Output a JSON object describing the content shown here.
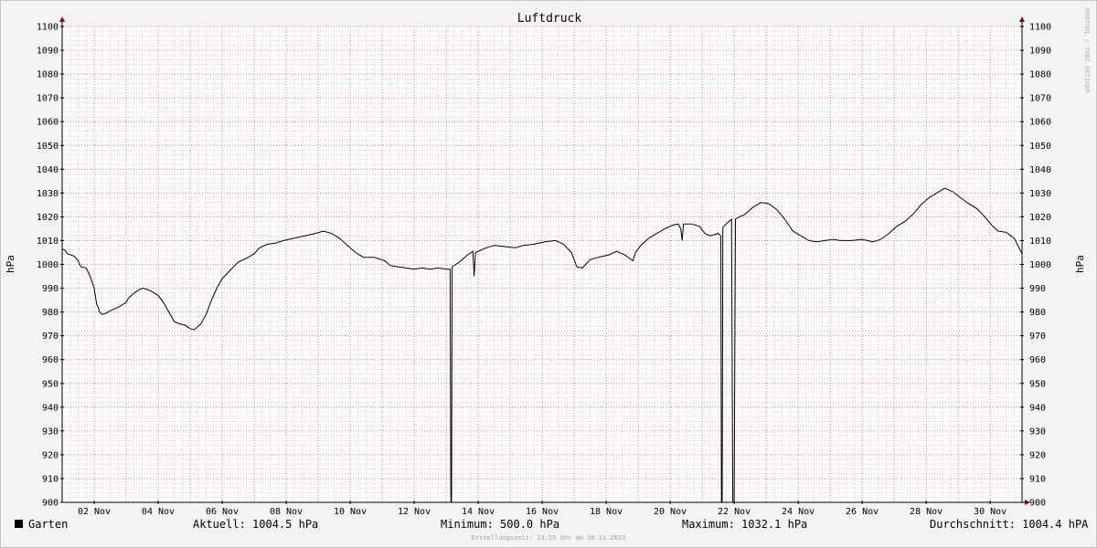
{
  "chart_data": {
    "type": "line",
    "title": "Luftdruck",
    "ylabel": "hPa",
    "ylabel_right": "hPa",
    "ylim": [
      900,
      1100
    ],
    "xlim": [
      "2023-11-01T00:00",
      "2023-11-30T23:55"
    ],
    "yticks": [
      900,
      910,
      920,
      930,
      940,
      950,
      960,
      970,
      980,
      990,
      1000,
      1010,
      1020,
      1030,
      1040,
      1050,
      1060,
      1070,
      1080,
      1090,
      1100
    ],
    "xticks": [
      {
        "label": "02 Nov",
        "value": "2023-11-02T00:00"
      },
      {
        "label": "04 Nov",
        "value": "2023-11-04T00:00"
      },
      {
        "label": "06 Nov",
        "value": "2023-11-06T00:00"
      },
      {
        "label": "08 Nov",
        "value": "2023-11-08T00:00"
      },
      {
        "label": "10 Nov",
        "value": "2023-11-10T00:00"
      },
      {
        "label": "12 Nov",
        "value": "2023-11-12T00:00"
      },
      {
        "label": "14 Nov",
        "value": "2023-11-14T00:00"
      },
      {
        "label": "16 Nov",
        "value": "2023-11-16T00:00"
      },
      {
        "label": "18 Nov",
        "value": "2023-11-18T00:00"
      },
      {
        "label": "20 Nov",
        "value": "2023-11-20T00:00"
      },
      {
        "label": "22 Nov",
        "value": "2023-11-22T00:00"
      },
      {
        "label": "24 Nov",
        "value": "2023-11-24T00:00"
      },
      {
        "label": "26 Nov",
        "value": "2023-11-26T00:00"
      },
      {
        "label": "28 Nov",
        "value": "2023-11-28T00:00"
      },
      {
        "label": "30 Nov",
        "value": "2023-11-30T00:00"
      }
    ],
    "grid": true,
    "series": [
      {
        "name": "Garten",
        "color": "#000000",
        "points": [
          [
            "2023-11-01T00:00",
            1006.5
          ],
          [
            "2023-11-01T02:00",
            1006
          ],
          [
            "2023-11-01T04:00",
            1004.5
          ],
          [
            "2023-11-01T09:00",
            1003.5
          ],
          [
            "2023-11-01T12:00",
            1001.5
          ],
          [
            "2023-11-01T14:00",
            999
          ],
          [
            "2023-11-01T18:00",
            998.5
          ],
          [
            "2023-11-01T21:00",
            995
          ],
          [
            "2023-11-02T00:00",
            990
          ],
          [
            "2023-11-02T02:00",
            983
          ],
          [
            "2023-11-02T03:00",
            982
          ],
          [
            "2023-11-02T04:00",
            980
          ],
          [
            "2023-11-02T06:00",
            979
          ],
          [
            "2023-11-02T09:00",
            979.5
          ],
          [
            "2023-11-02T12:00",
            980.5
          ],
          [
            "2023-11-02T18:00",
            982
          ],
          [
            "2023-11-03T00:00",
            984
          ],
          [
            "2023-11-03T02:00",
            986
          ],
          [
            "2023-11-03T06:00",
            988
          ],
          [
            "2023-11-03T10:00",
            989.5
          ],
          [
            "2023-11-03T13:00",
            990
          ],
          [
            "2023-11-03T18:00",
            989
          ],
          [
            "2023-11-04T00:00",
            987
          ],
          [
            "2023-11-04T04:00",
            984
          ],
          [
            "2023-11-04T08:00",
            980
          ],
          [
            "2023-11-04T12:00",
            976
          ],
          [
            "2023-11-04T16:00",
            975
          ],
          [
            "2023-11-04T20:00",
            974.5
          ],
          [
            "2023-11-05T00:00",
            973
          ],
          [
            "2023-11-05T03:00",
            972.5
          ],
          [
            "2023-11-05T08:00",
            975
          ],
          [
            "2023-11-05T12:00",
            979
          ],
          [
            "2023-11-05T16:00",
            985
          ],
          [
            "2023-11-05T20:00",
            990
          ],
          [
            "2023-11-06T00:00",
            994
          ],
          [
            "2023-11-06T06:00",
            997.5
          ],
          [
            "2023-11-06T12:00",
            1001
          ],
          [
            "2023-11-06T18:00",
            1002.5
          ],
          [
            "2023-11-07T00:00",
            1004.5
          ],
          [
            "2023-11-07T04:00",
            1007
          ],
          [
            "2023-11-07T10:00",
            1008.5
          ],
          [
            "2023-11-07T16:00",
            1009
          ],
          [
            "2023-11-07T22:00",
            1010
          ],
          [
            "2023-11-08T06:00",
            1011
          ],
          [
            "2023-11-08T14:00",
            1012
          ],
          [
            "2023-11-08T22:00",
            1013
          ],
          [
            "2023-11-09T04:00",
            1014
          ],
          [
            "2023-11-09T10:00",
            1013
          ],
          [
            "2023-11-09T16:00",
            1011
          ],
          [
            "2023-11-09T22:00",
            1008
          ],
          [
            "2023-11-10T04:00",
            1005
          ],
          [
            "2023-11-10T10:00",
            1003
          ],
          [
            "2023-11-10T18:00",
            1003
          ],
          [
            "2023-11-11T02:00",
            1001.5
          ],
          [
            "2023-11-11T06:00",
            999.5
          ],
          [
            "2023-11-11T12:00",
            999
          ],
          [
            "2023-11-11T18:00",
            998.5
          ],
          [
            "2023-11-12T00:00",
            998
          ],
          [
            "2023-11-12T06:00",
            998.5
          ],
          [
            "2023-11-12T12:00",
            998
          ],
          [
            "2023-11-12T18:00",
            998.5
          ],
          [
            "2023-11-13T00:00",
            998
          ],
          [
            "2023-11-13T03:00",
            998
          ],
          [
            "2023-11-13T03:30",
            900
          ],
          [
            "2023-11-13T04:00",
            900
          ],
          [
            "2023-11-13T04:30",
            999
          ],
          [
            "2023-11-13T10:00",
            1001
          ],
          [
            "2023-11-13T16:00",
            1004
          ],
          [
            "2023-11-13T20:00",
            1005.5
          ],
          [
            "2023-11-13T21:00",
            995
          ],
          [
            "2023-11-13T22:00",
            1005
          ],
          [
            "2023-11-14T06:00",
            1007
          ],
          [
            "2023-11-14T12:00",
            1008
          ],
          [
            "2023-11-14T20:00",
            1007.5
          ],
          [
            "2023-11-15T04:00",
            1007
          ],
          [
            "2023-11-15T10:00",
            1008
          ],
          [
            "2023-11-15T18:00",
            1008.5
          ],
          [
            "2023-11-16T02:00",
            1009.5
          ],
          [
            "2023-11-16T10:00",
            1010
          ],
          [
            "2023-11-16T16:00",
            1008.5
          ],
          [
            "2023-11-16T22:00",
            1005
          ],
          [
            "2023-11-17T02:00",
            999
          ],
          [
            "2023-11-17T06:00",
            998.5
          ],
          [
            "2023-11-17T12:00",
            1002
          ],
          [
            "2023-11-17T18:00",
            1003
          ],
          [
            "2023-11-18T02:00",
            1004
          ],
          [
            "2023-11-18T08:00",
            1005.5
          ],
          [
            "2023-11-18T14:00",
            1004
          ],
          [
            "2023-11-18T20:00",
            1001.5
          ],
          [
            "2023-11-18T22:00",
            1005
          ],
          [
            "2023-11-19T02:00",
            1008
          ],
          [
            "2023-11-19T08:00",
            1011
          ],
          [
            "2023-11-19T14:00",
            1013
          ],
          [
            "2023-11-19T20:00",
            1015
          ],
          [
            "2023-11-20T02:00",
            1016.5
          ],
          [
            "2023-11-20T06:00",
            1017
          ],
          [
            "2023-11-20T08:00",
            1015
          ],
          [
            "2023-11-20T09:00",
            1010
          ],
          [
            "2023-11-20T10:00",
            1017
          ],
          [
            "2023-11-20T16:00",
            1017
          ],
          [
            "2023-11-20T22:00",
            1016
          ],
          [
            "2023-11-21T02:00",
            1013
          ],
          [
            "2023-11-21T06:00",
            1012
          ],
          [
            "2023-11-21T12:00",
            1013
          ],
          [
            "2023-11-21T14:00",
            1012
          ],
          [
            "2023-11-21T14:30",
            900
          ],
          [
            "2023-11-21T15:00",
            900
          ],
          [
            "2023-11-21T15:30",
            1015.5
          ],
          [
            "2023-11-21T18:00",
            1017
          ],
          [
            "2023-11-21T22:00",
            1019
          ],
          [
            "2023-11-21T23:00",
            900
          ],
          [
            "2023-11-22T00:00",
            900
          ],
          [
            "2023-11-22T01:00",
            1019
          ],
          [
            "2023-11-22T04:00",
            1020
          ],
          [
            "2023-11-22T08:00",
            1021
          ],
          [
            "2023-11-22T14:00",
            1024
          ],
          [
            "2023-11-22T20:00",
            1026
          ],
          [
            "2023-11-23T02:00",
            1025.5
          ],
          [
            "2023-11-23T08:00",
            1023
          ],
          [
            "2023-11-23T14:00",
            1019
          ],
          [
            "2023-11-23T20:00",
            1014
          ],
          [
            "2023-11-24T02:00",
            1012
          ],
          [
            "2023-11-24T08:00",
            1010
          ],
          [
            "2023-11-24T14:00",
            1009.5
          ],
          [
            "2023-11-24T20:00",
            1010
          ],
          [
            "2023-11-25T02:00",
            1010.5
          ],
          [
            "2023-11-25T08:00",
            1010
          ],
          [
            "2023-11-25T16:00",
            1010
          ],
          [
            "2023-11-26T00:00",
            1010.5
          ],
          [
            "2023-11-26T04:00",
            1010
          ],
          [
            "2023-11-26T08:00",
            1009.5
          ],
          [
            "2023-11-26T14:00",
            1010.5
          ],
          [
            "2023-11-26T20:00",
            1013
          ],
          [
            "2023-11-27T02:00",
            1016
          ],
          [
            "2023-11-27T08:00",
            1018
          ],
          [
            "2023-11-27T14:00",
            1021
          ],
          [
            "2023-11-27T20:00",
            1025
          ],
          [
            "2023-11-28T02:00",
            1028
          ],
          [
            "2023-11-28T08:00",
            1030
          ],
          [
            "2023-11-28T14:00",
            1032
          ],
          [
            "2023-11-28T20:00",
            1030.5
          ],
          [
            "2023-11-29T02:00",
            1028
          ],
          [
            "2023-11-29T08:00",
            1025.5
          ],
          [
            "2023-11-29T14:00",
            1023.5
          ],
          [
            "2023-11-29T20:00",
            1020
          ],
          [
            "2023-11-30T02:00",
            1016
          ],
          [
            "2023-11-30T06:00",
            1014
          ],
          [
            "2023-11-30T12:00",
            1013.5
          ],
          [
            "2023-11-30T18:00",
            1011
          ],
          [
            "2023-11-30T23:55",
            1004.5
          ]
        ]
      }
    ]
  },
  "legend": {
    "series_name": "Garten",
    "current": "Aktuell: 1004.5 hPa",
    "minimum": "Minimum: 500.0 hPa",
    "maximum": "Maximum: 1032.1 hPa",
    "average": "Durchschnitt: 1004.4 hPA"
  },
  "watermark": "RRDTOOL / TOBI OETIKER",
  "footer": "Erstellungszeit: 23:55 Uhr am 30.11.2023",
  "colors": {
    "background": "#f3f3f3",
    "plot_background": "#ffffff",
    "grid_minor": "#e8c4c4",
    "grid_major": "#e47e7e",
    "axis": "#000000",
    "arrow": "#a00000",
    "line": "#000000"
  }
}
